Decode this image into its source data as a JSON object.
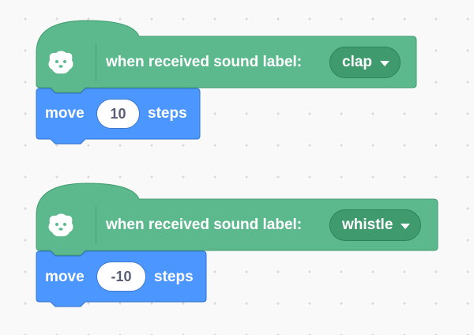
{
  "scripts": [
    {
      "hat": {
        "text": "when received sound label:",
        "dropdown_value": "clap",
        "icon": "ml-sound-icon"
      },
      "motion": {
        "label_before": "move",
        "value": "10",
        "label_after": "steps"
      }
    },
    {
      "hat": {
        "text": "when received sound label:",
        "dropdown_value": "whistle",
        "icon": "ml-sound-icon"
      },
      "motion": {
        "label_before": "move",
        "value": "-10",
        "label_after": "steps"
      }
    }
  ],
  "colors": {
    "hat_block": "#5cb98d",
    "hat_border": "#3f9b6e",
    "motion_block": "#4c97ff",
    "motion_border": "#3373cc",
    "canvas": "#f9f9f9"
  }
}
